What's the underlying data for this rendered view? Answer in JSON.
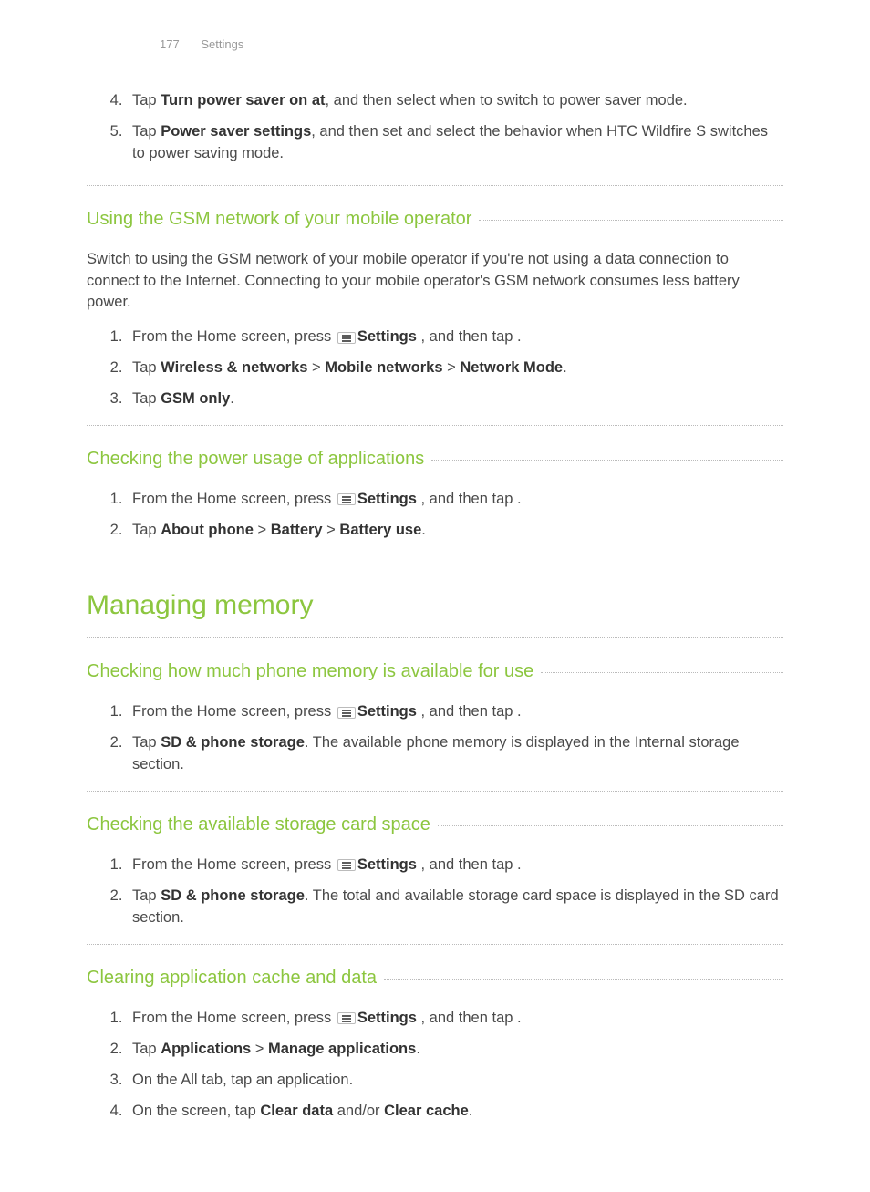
{
  "header": {
    "page_number": "177",
    "section_name": "Settings"
  },
  "top_steps": {
    "start": 4,
    "items": [
      {
        "pre": "Tap ",
        "bold": "Turn power saver on at",
        "post": ", and then select when to switch to power saver mode."
      },
      {
        "pre": "Tap ",
        "bold": "Power saver settings",
        "post": ", and then set and select the behavior when HTC Wildfire S switches to power saving mode."
      }
    ]
  },
  "sec_gsm": {
    "title": "Using the GSM network of your mobile operator",
    "body": "Switch to using the GSM network of your mobile operator if you're not using a data connection to connect to the Internet. Connecting to your mobile operator's GSM network consumes less battery power.",
    "steps": [
      {
        "pre": "From the Home screen, press ",
        "icon": true,
        "mid": " , and then tap ",
        "bold": "Settings",
        "post": "."
      },
      {
        "pre": "Tap ",
        "bold": "Wireless & networks",
        "mid": " > ",
        "bold2": "Mobile networks",
        "mid2": " > ",
        "bold3": "Network Mode",
        "post": "."
      },
      {
        "pre": "Tap ",
        "bold": "GSM only",
        "post": "."
      }
    ]
  },
  "sec_power_usage": {
    "title": "Checking the power usage of applications",
    "steps": [
      {
        "pre": "From the Home screen, press ",
        "icon": true,
        "mid": " , and then tap ",
        "bold": "Settings",
        "post": "."
      },
      {
        "pre": "Tap ",
        "bold": "About phone",
        "mid": " > ",
        "bold2": "Battery",
        "mid2": " > ",
        "bold3": "Battery use",
        "post": "."
      }
    ]
  },
  "main_heading": "Managing memory",
  "sec_phone_mem": {
    "title": "Checking how much phone memory is available for use",
    "steps": [
      {
        "pre": "From the Home screen, press ",
        "icon": true,
        "mid": " , and then tap ",
        "bold": "Settings",
        "post": "."
      },
      {
        "pre": "Tap ",
        "bold": "SD & phone storage",
        "post": ". The available phone memory is displayed in the Internal storage section."
      }
    ]
  },
  "sec_card_space": {
    "title": "Checking the available storage card space",
    "steps": [
      {
        "pre": "From the Home screen, press ",
        "icon": true,
        "mid": " , and then tap ",
        "bold": "Settings",
        "post": "."
      },
      {
        "pre": "Tap ",
        "bold": "SD & phone storage",
        "post": ". The total and available storage card space is displayed in the SD card section."
      }
    ]
  },
  "sec_clear": {
    "title": "Clearing application cache and data",
    "steps": [
      {
        "pre": "From the Home screen, press ",
        "icon": true,
        "mid": " , and then tap ",
        "bold": "Settings",
        "post": "."
      },
      {
        "pre": "Tap ",
        "bold": "Applications",
        "mid": " > ",
        "bold2": "Manage applications",
        "post": "."
      },
      {
        "pre": "On the All tab, tap an application."
      },
      {
        "pre": "On the screen, tap ",
        "bold": "Clear data",
        "mid": " and/or ",
        "bold2": "Clear cache",
        "post": "."
      }
    ]
  }
}
